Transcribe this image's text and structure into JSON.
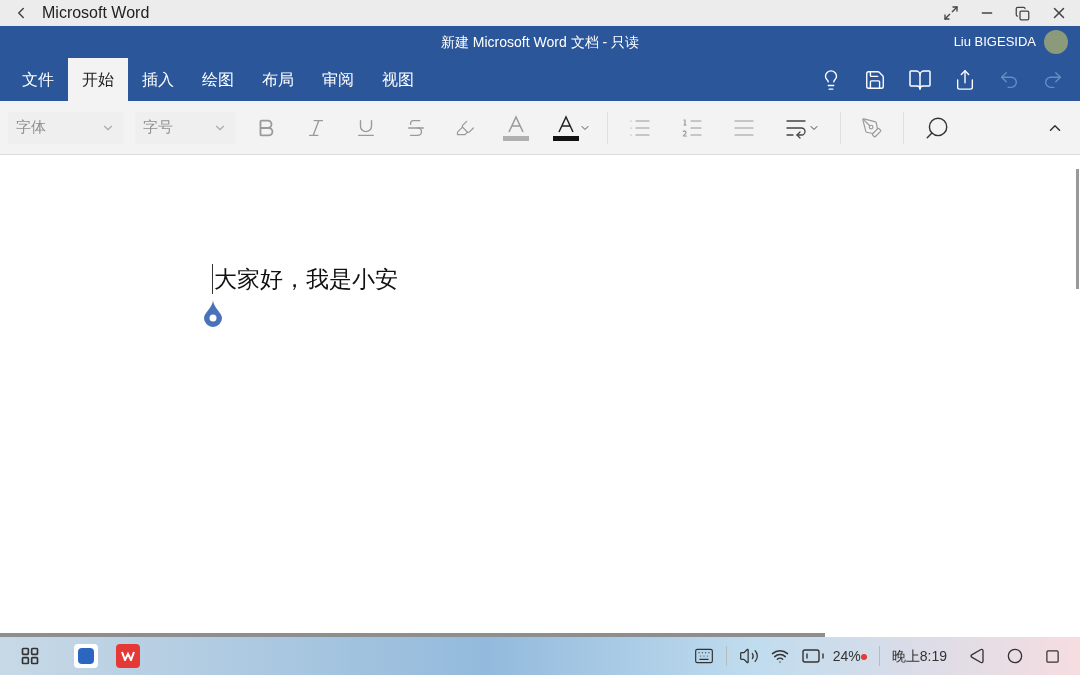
{
  "window": {
    "title": "Microsoft Word"
  },
  "header": {
    "document_title": "新建 Microsoft Word 文档 - 只读",
    "user_name": "Liu BIGESIDA"
  },
  "tabs": [
    {
      "label": "文件",
      "selected": false
    },
    {
      "label": "开始",
      "selected": true
    },
    {
      "label": "插入",
      "selected": false
    },
    {
      "label": "绘图",
      "selected": false
    },
    {
      "label": "布局",
      "selected": false
    },
    {
      "label": "审阅",
      "selected": false
    },
    {
      "label": "视图",
      "selected": false
    }
  ],
  "toolbar": {
    "font_placeholder": "字体",
    "size_placeholder": "字号"
  },
  "document": {
    "text": "大家好，我是小安"
  },
  "taskbar": {
    "battery": "24%",
    "time": "晚上8:19"
  }
}
